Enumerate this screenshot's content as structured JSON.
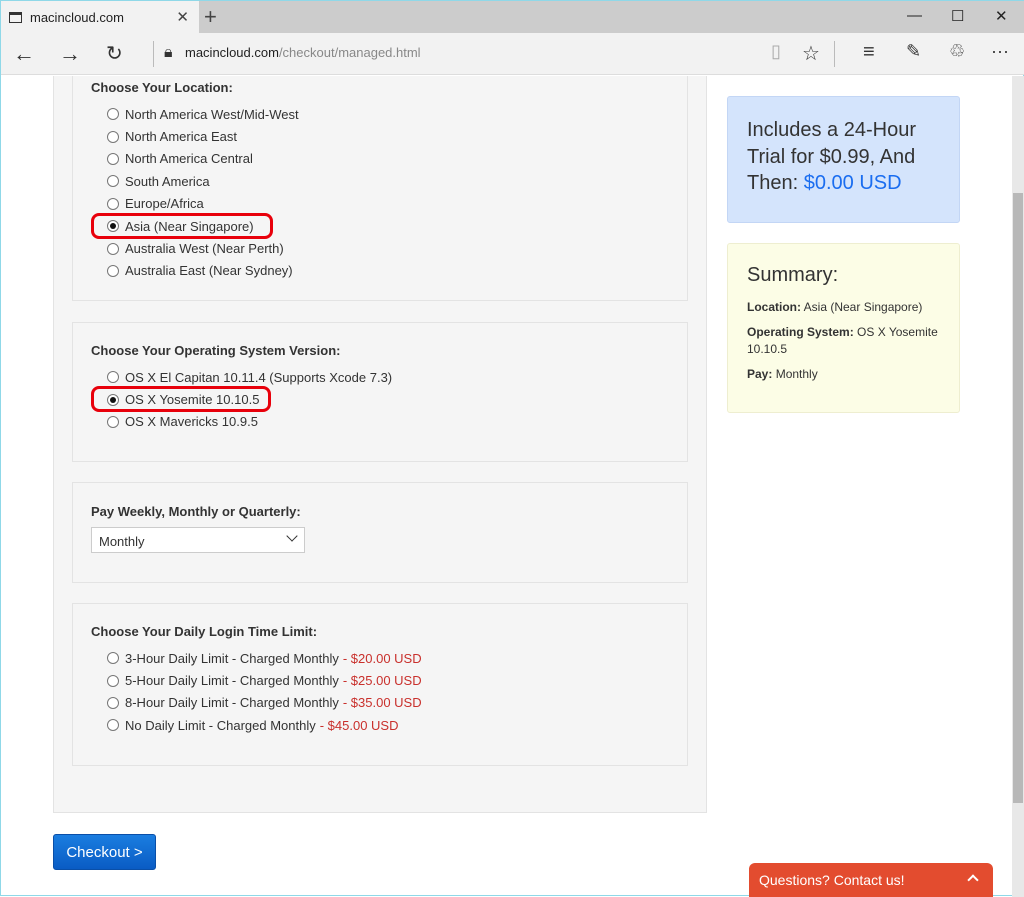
{
  "browser": {
    "tab_title": "macincloud.com",
    "url_host": "macincloud.com",
    "url_path": "/checkout/managed.html"
  },
  "location": {
    "title": "Choose Your Location:",
    "options": [
      "North America West/Mid-West",
      "North America East",
      "North America Central",
      "South America",
      "Europe/Africa",
      "Asia (Near Singapore)",
      "Australia West (Near Perth)",
      "Australia East (Near Sydney)"
    ],
    "selected": "Asia (Near Singapore)"
  },
  "os": {
    "title": "Choose Your Operating System Version:",
    "options": [
      "OS X El Capitan 10.11.4 (Supports Xcode 7.3)",
      "OS X Yosemite 10.10.5",
      "OS X Mavericks 10.9.5"
    ],
    "selected": "OS X Yosemite 10.10.5"
  },
  "pay": {
    "title": "Pay Weekly, Monthly or Quarterly:",
    "selected": "Monthly"
  },
  "limit": {
    "title": "Choose Your Daily Login Time Limit:",
    "options": [
      {
        "label": "3-Hour Daily Limit - Charged Monthly",
        "price": "- $20.00 USD"
      },
      {
        "label": "5-Hour Daily Limit - Charged Monthly",
        "price": "- $25.00 USD"
      },
      {
        "label": "8-Hour Daily Limit - Charged Monthly",
        "price": "- $35.00 USD"
      },
      {
        "label": "No Daily Limit - Charged Monthly",
        "price": "- $45.00 USD"
      }
    ]
  },
  "trial": {
    "text": "Includes a 24-Hour Trial for $0.99, And Then:",
    "price": "$0.00 USD"
  },
  "summary": {
    "title": "Summary:",
    "location_label": "Location:",
    "location": "Asia (Near Singapore)",
    "os_label": "Operating System:",
    "os": "OS X Yosemite 10.10.5",
    "pay_label": "Pay:",
    "pay": "Monthly"
  },
  "checkout_label": "Checkout >",
  "chat_label": "Questions? Contact us!",
  "colors": {
    "highlight": "#e8000b",
    "price": "#c9302c",
    "accent": "#1a6df0",
    "chat": "#e34c2f"
  }
}
